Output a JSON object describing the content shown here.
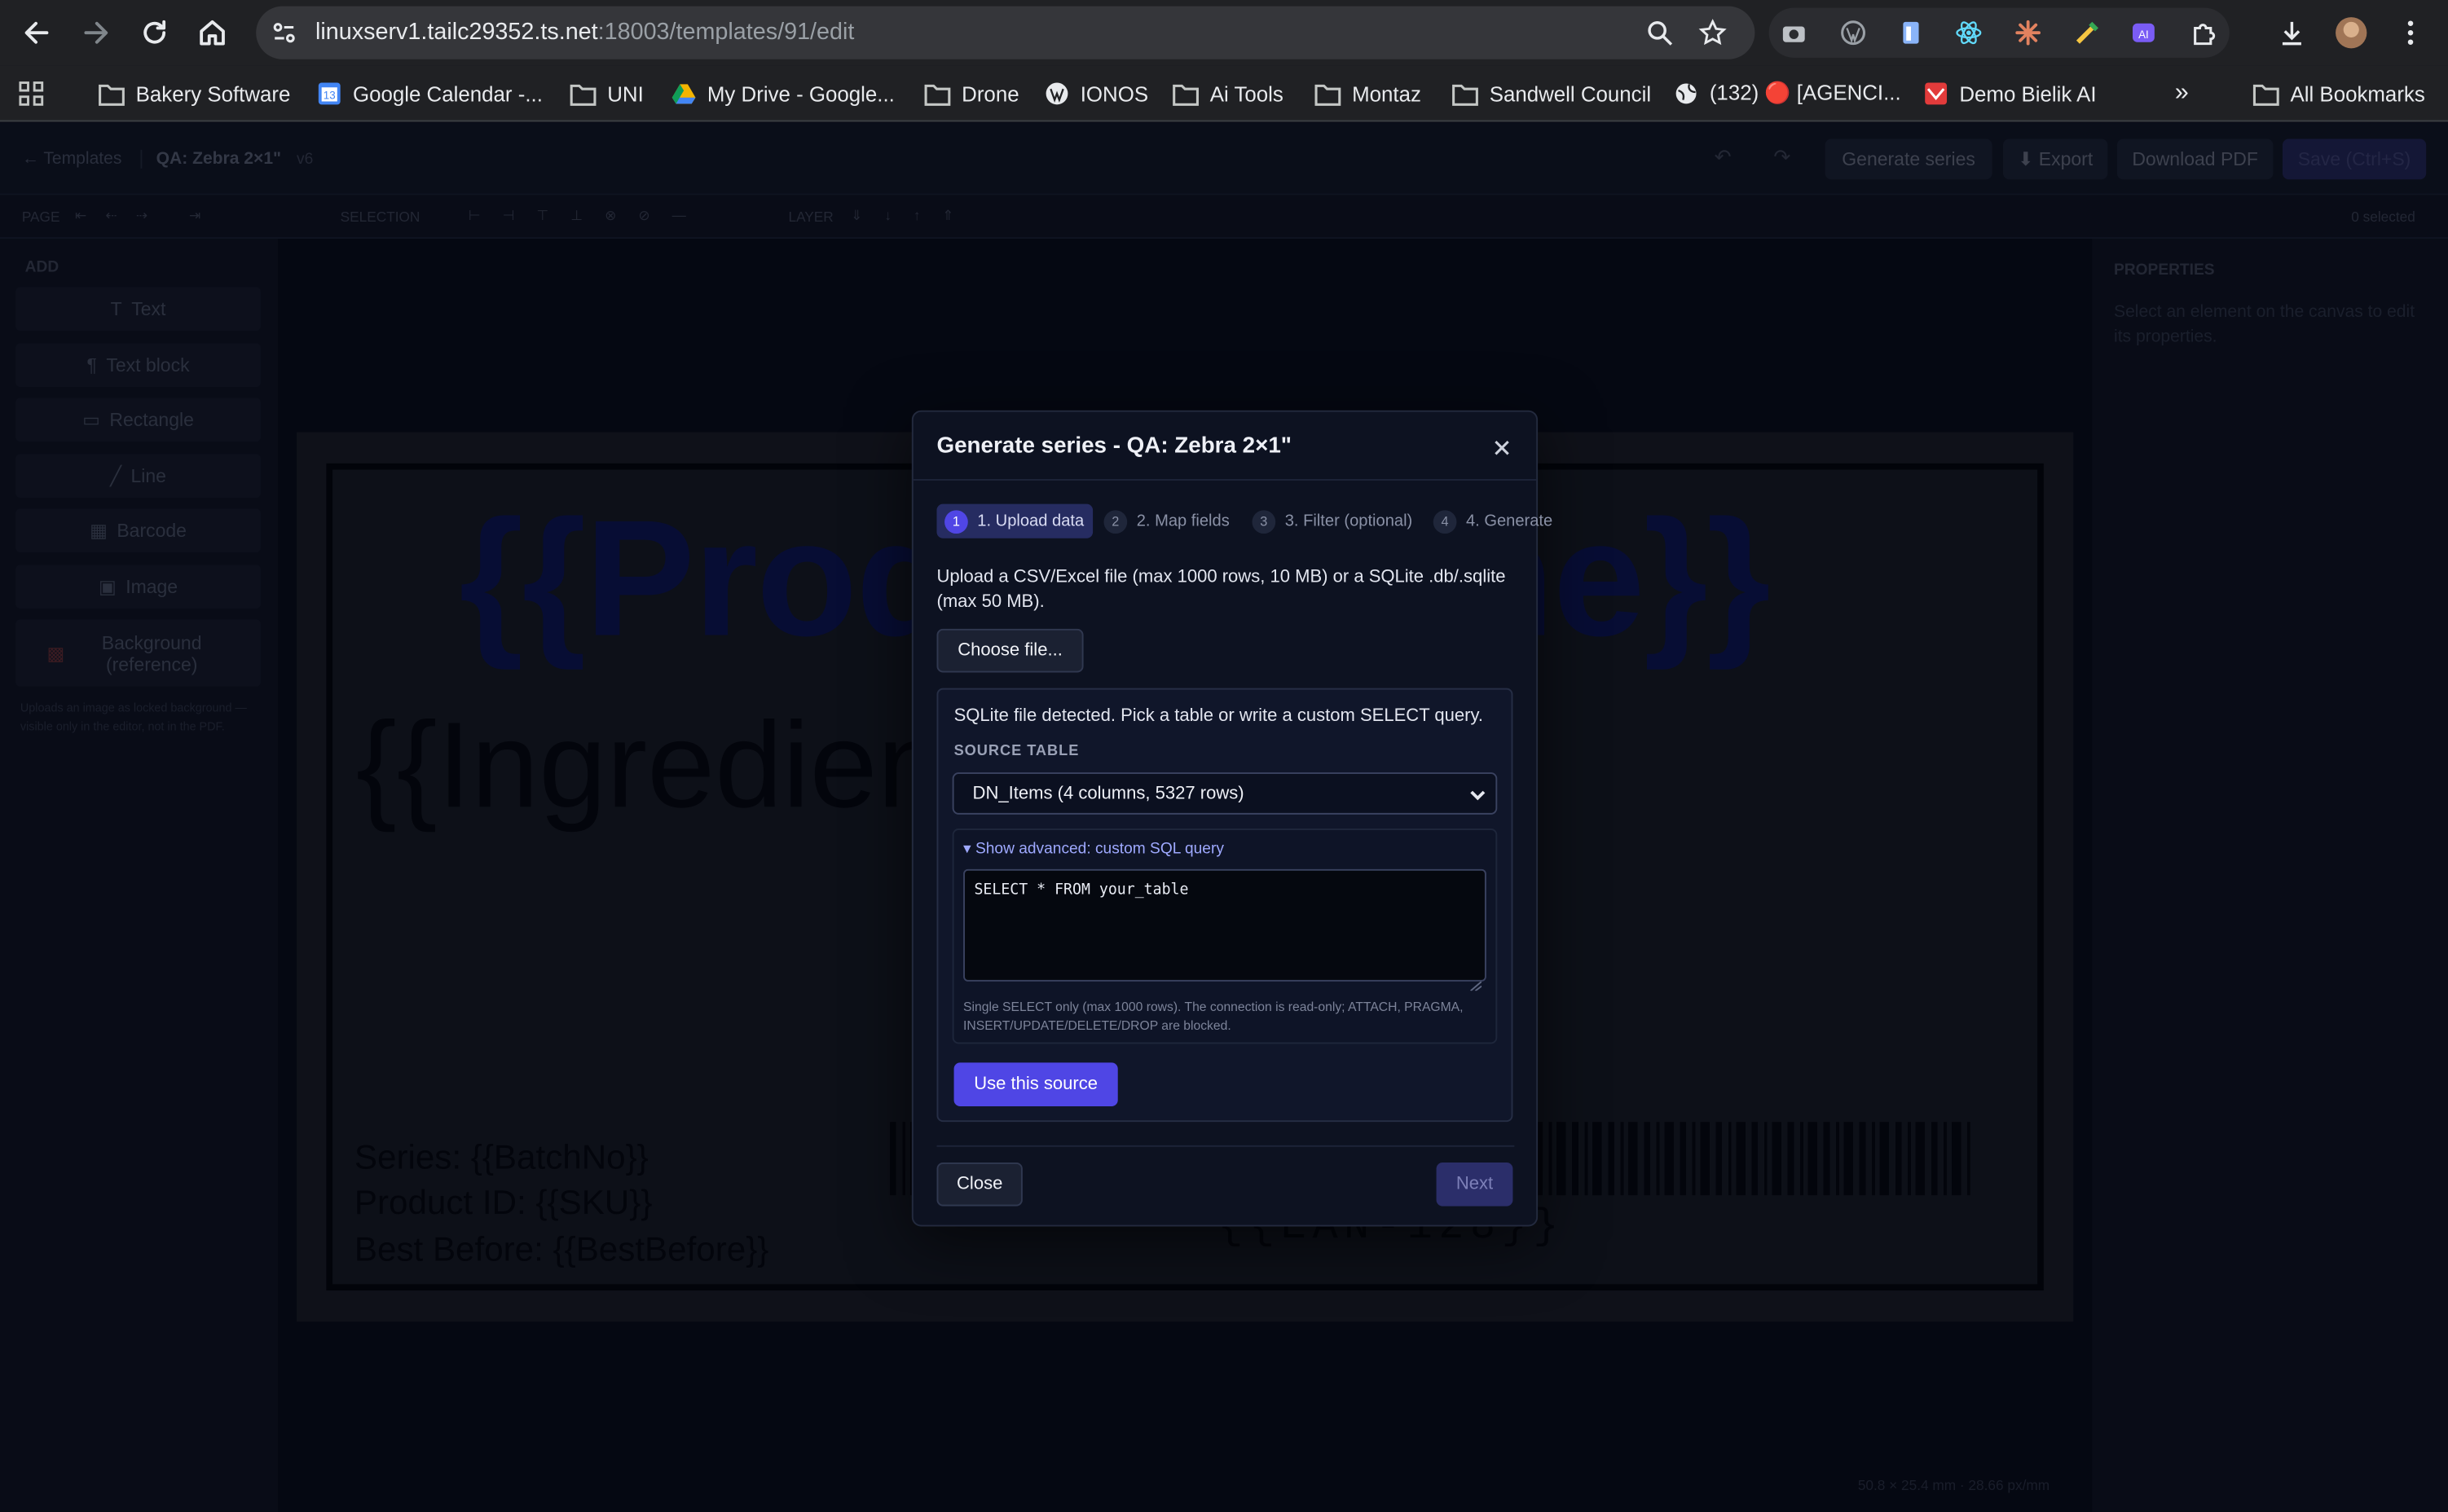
{
  "browser": {
    "url_host": "linuxserv1.tailc29352.ts.net",
    "url_path": ":18003/templates/91/edit",
    "bookmarks": [
      {
        "label": "Bakery Software",
        "icon": "folder-icon"
      },
      {
        "label": "Google Calendar -...",
        "icon": "google-calendar-icon"
      },
      {
        "label": "UNI",
        "icon": "folder-icon"
      },
      {
        "label": "My Drive - Google...",
        "icon": "google-drive-icon"
      },
      {
        "label": "Drone",
        "icon": "folder-icon"
      },
      {
        "label": "IONOS",
        "icon": "wordpress-icon"
      },
      {
        "label": "Ai Tools",
        "icon": "folder-icon"
      },
      {
        "label": "Montaz",
        "icon": "folder-icon"
      },
      {
        "label": "Sandwell Council",
        "icon": "folder-icon"
      },
      {
        "label": "(132) 🔴 [AGENCI...",
        "icon": "globe-icon"
      },
      {
        "label": "Demo Bielik AI",
        "icon": "bielik-icon"
      }
    ],
    "all_bookmarks": "All Bookmarks"
  },
  "app": {
    "breadcrumb_back": "← Templates",
    "template_name": "QA: Zebra 2×1\"",
    "version": "v6",
    "header_buttons": [
      "Generate series",
      "⬇ Export",
      "Download PDF",
      "Save (Ctrl+S)"
    ],
    "toolbar": {
      "page": "PAGE",
      "selection": "SELECTION",
      "layer": "LAYER",
      "selected": "0 selected"
    },
    "add_label": "ADD",
    "tools": [
      {
        "label": "Text",
        "glyph": "T"
      },
      {
        "label": "Text block",
        "glyph": "¶"
      },
      {
        "label": "Rectangle",
        "glyph": "▭"
      },
      {
        "label": "Line",
        "glyph": "╱"
      },
      {
        "label": "Barcode",
        "glyph": "▦"
      },
      {
        "label": "Image",
        "glyph": "▣"
      },
      {
        "label": "Background (reference)",
        "glyph": "▩"
      }
    ],
    "tool_note": "Uploads an image as locked background — visible only in the editor, not in the PDF.",
    "properties_title": "PROPERTIES",
    "properties_hint": "Select an element on the canvas to edit its properties.",
    "canvas_footer": "50.8 × 25.4 mm · 28.66 px/mm",
    "label": {
      "product_name": "{{ProductName}}",
      "ingredients": "{{Ingredients}}",
      "series": "Series: {{BatchNo}}",
      "product_id": "Product ID: {{SKU}}",
      "best_before": "Best Before: {{BestBefore}}",
      "ean": "{{EAN-128}}"
    }
  },
  "modal": {
    "title": "Generate series - QA: Zebra 2×1\"",
    "steps": [
      {
        "num": "1",
        "label": "1. Upload data",
        "active": true
      },
      {
        "num": "2",
        "label": "2. Map fields",
        "active": false
      },
      {
        "num": "3",
        "label": "3. Filter (optional)",
        "active": false
      },
      {
        "num": "4",
        "label": "4. Generate",
        "active": false
      }
    ],
    "description": "Upload a CSV/Excel file (max 1000 rows, 10 MB) or a SQLite .db/.sqlite (max 50 MB).",
    "choose_file": "Choose file...",
    "detected": "SQLite file detected. Pick a table or write a custom SELECT query.",
    "source_table_label": "SOURCE TABLE",
    "source_table_value": "DN_Items (4 columns, 5327 rows)",
    "advanced_toggle": "▾ Show advanced: custom SQL query",
    "sql_query": "SELECT * FROM your_table",
    "sql_help": "Single SELECT only (max 1000 rows). The connection is read-only; ATTACH, PRAGMA, INSERT/UPDATE/DELETE/DROP are blocked.",
    "use_source": "Use this source",
    "close": "Close",
    "next": "Next"
  }
}
